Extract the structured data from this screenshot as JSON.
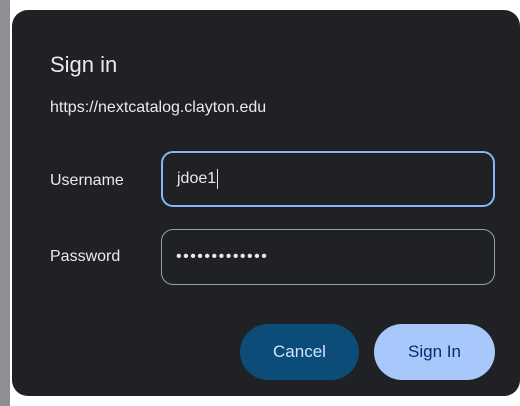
{
  "dialog": {
    "title": "Sign in",
    "url": "https://nextcatalog.clayton.edu"
  },
  "form": {
    "username_label": "Username",
    "username_value": "jdoe1",
    "password_label": "Password",
    "password_mask": "•••••••••••••"
  },
  "buttons": {
    "cancel_label": "Cancel",
    "signin_label": "Sign In"
  },
  "colors": {
    "dialog_bg": "#202124",
    "text": "#e8eaed",
    "focus_border": "#8ab4f8",
    "cancel_bg": "#0b4d78",
    "signin_bg": "#a8c7fa"
  }
}
